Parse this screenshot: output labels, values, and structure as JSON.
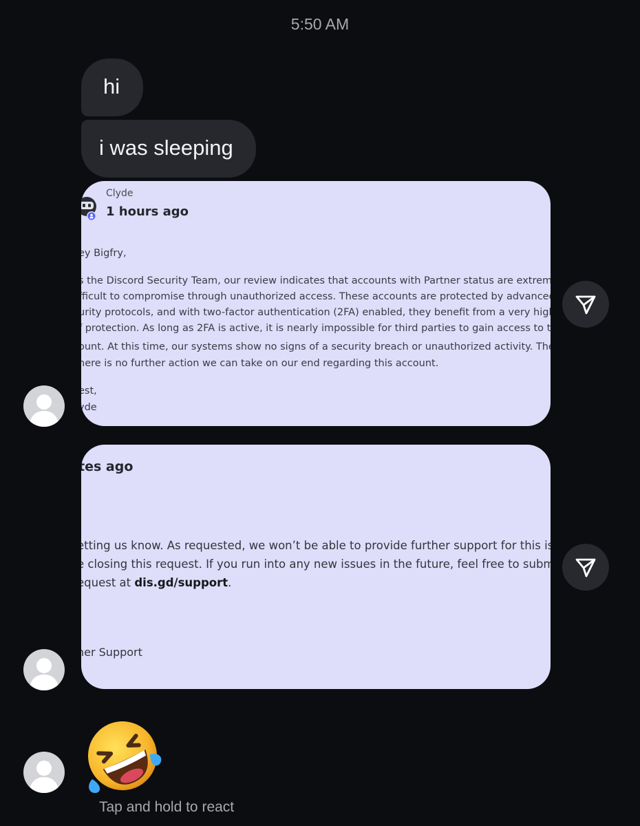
{
  "header": {
    "time": "5:50 AM"
  },
  "messages": {
    "bubble_1": "hi",
    "bubble_2": "i was sleeping"
  },
  "screenshot_1": {
    "sender": "Clyde",
    "time_ago": "1 hours ago",
    "lines": [
      "ey Bigfry,",
      "s the Discord Security Team, our review indicates that accounts with Partner status are extremely",
      "fficult to compromise through unauthorized access. These accounts are protected by advanced se-",
      "urity protocols, and with two-factor authentication (2FA) enabled, they benefit from a very high leve",
      "f protection. As long as 2FA is active, it is nearly impossible for third parties to gain access to the ac-",
      "ount. At this time, our systems show no signs of a security breach or unauthorized activity. Therefore",
      "here is no further action we can take on our end regarding this account.",
      "est,",
      "yde"
    ]
  },
  "screenshot_2": {
    "time_ago": "tes ago",
    "lines": [
      "etting us know. As requested, we won’t be able to provide further support for this is-",
      "e closing this request. If you run into any new issues in the future, feel free to submit a",
      "equest at "
    ],
    "link": "dis.gd/support",
    "link_suffix": ".",
    "signature": "ner Support"
  },
  "footer": {
    "reaction_hint": "Tap and hold to react"
  },
  "icons": {
    "share": "send-paper-plane-icon",
    "emoji": "rolling-on-the-floor-laughing"
  },
  "colors": {
    "background": "#0c0d11",
    "bubble": "#26282d",
    "screenshot_bg": "#dedefa"
  }
}
